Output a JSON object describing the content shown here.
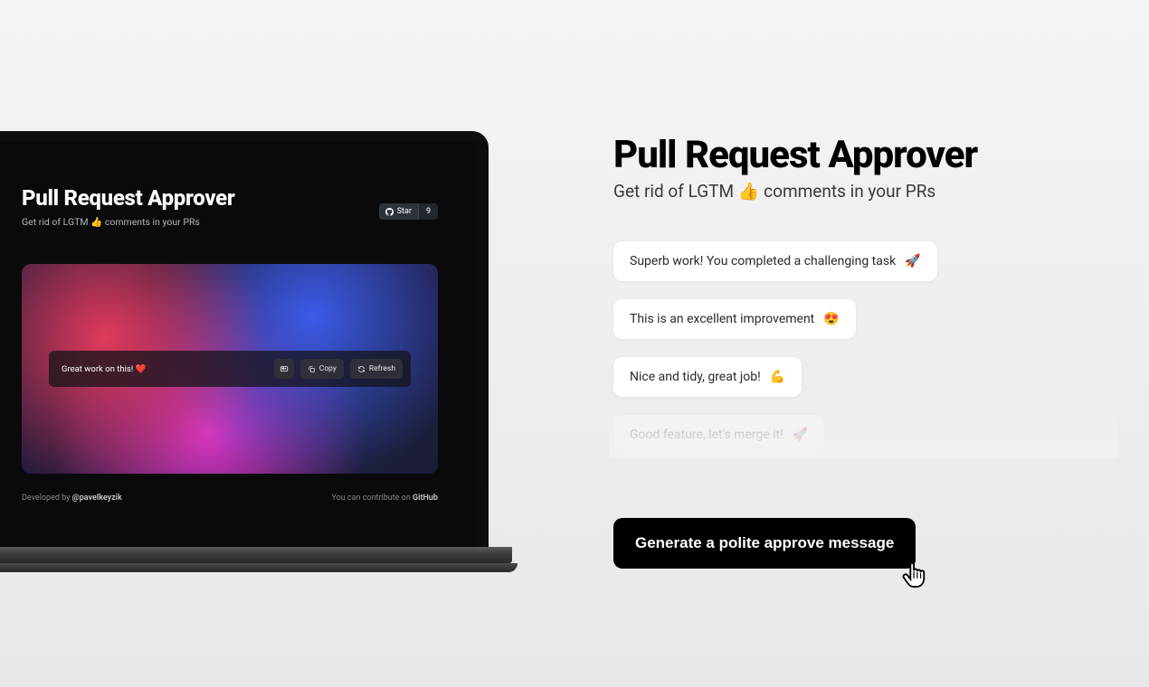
{
  "app": {
    "title": "Pull Request Approver",
    "subtitle": "Get rid of LGTM 👍 comments in your PRs",
    "star_label": "Star",
    "star_count": "9",
    "message": "Great work on this! ❤️",
    "copy_label": "Copy",
    "refresh_label": "Refresh",
    "developed_by_prefix": "Developed by ",
    "developed_by_handle": "@pavelkeyzik",
    "contribute_prefix": "You can contribute on ",
    "contribute_link": "GitHub"
  },
  "marketing": {
    "title": "Pull Request Approver",
    "subtitle_before": "Get rid of LGTM ",
    "subtitle_emoji": "👍",
    "subtitle_after": " comments in your PRs",
    "examples": [
      {
        "text": "Superb work! You completed a challenging task",
        "emoji": "🚀"
      },
      {
        "text": "This is an excellent improvement",
        "emoji": "😍"
      },
      {
        "text": "Nice and tidy, great job!",
        "emoji": "💪"
      },
      {
        "text": "Good feature, let's merge it!",
        "emoji": "🚀"
      }
    ],
    "cta": "Generate a polite approve message"
  }
}
